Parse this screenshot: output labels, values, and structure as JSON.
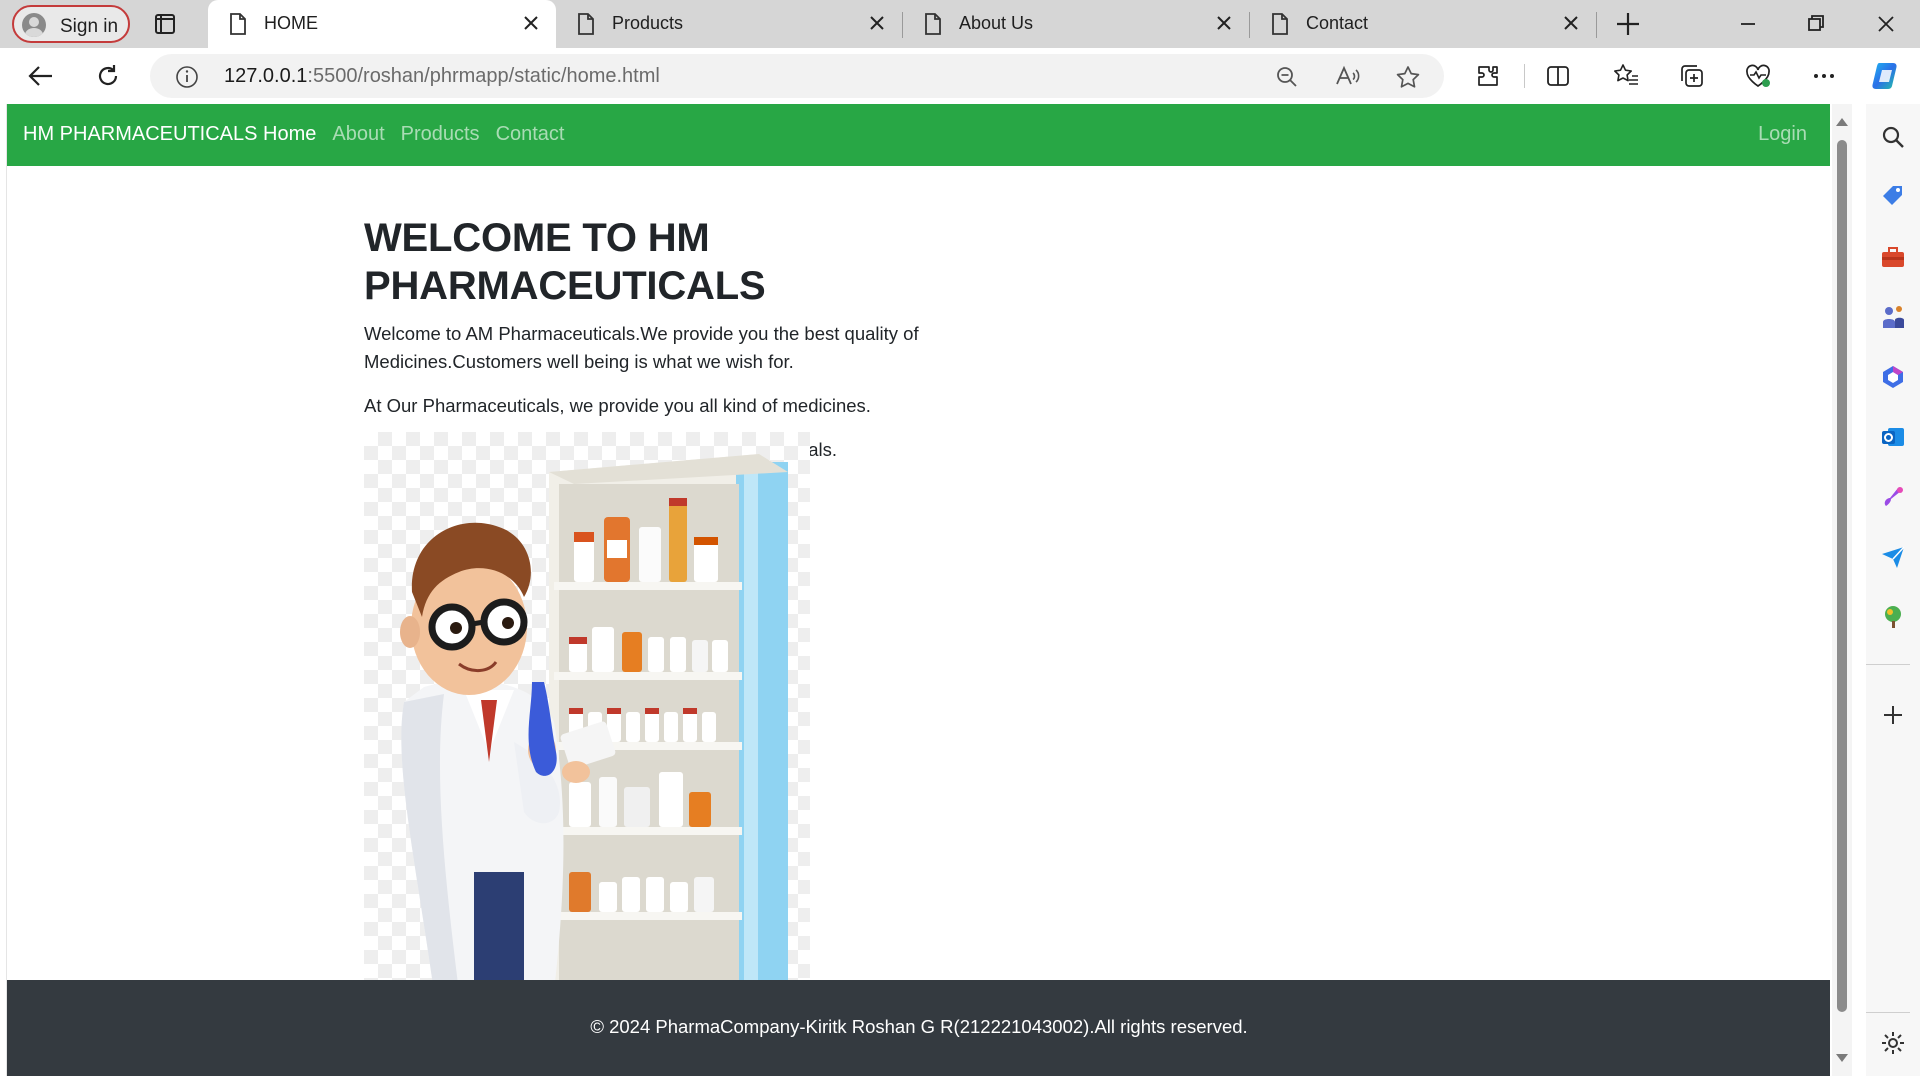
{
  "browser": {
    "signin_label": "Sign in",
    "tabs": [
      {
        "label": "HOME",
        "active": true
      },
      {
        "label": "Products",
        "active": false
      },
      {
        "label": "About Us",
        "active": false
      },
      {
        "label": "Contact",
        "active": false
      }
    ],
    "url_host": "127.0.0.1",
    "url_rest": ":5500/roshan/phrmapp/static/home.html"
  },
  "site": {
    "brand": "HM PHARMACEUTICALS",
    "nav": [
      "Home",
      "About",
      "Products",
      "Contact"
    ],
    "login": "Login",
    "accent_color": "#28a745",
    "footer_color": "#343a40"
  },
  "main": {
    "heading": "WELCOME TO HM PHARMACEUTICALS",
    "paragraphs": [
      "Welcome to AM Pharmaceuticals.We provide you the best quality of Medicines.Customers well being is what we wish for.",
      "At Our Pharmaceuticals, we provide you all kind of medicines.",
      "Thank you for choosing and trusting AM Pharmaceuticals."
    ]
  },
  "footer": {
    "text": "© 2024 PharmaCompany-Kiritk Roshan G R(212221043002).All rights reserved."
  }
}
